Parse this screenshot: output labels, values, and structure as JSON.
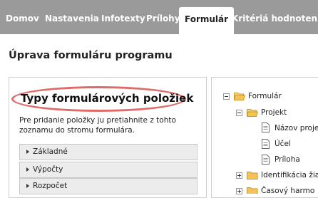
{
  "nav": {
    "tabs": [
      {
        "label": "Domov"
      },
      {
        "label": "Nastavenia"
      },
      {
        "label": "Infotexty"
      },
      {
        "label": "Prílohy"
      },
      {
        "label": "Formulár",
        "active": true
      },
      {
        "label": "Kritériá hodnotenia"
      }
    ]
  },
  "page": {
    "title": "Úprava formuláru programu"
  },
  "left_panel": {
    "heading": "Typy formulárových položiek",
    "instructions": "Pre pridanie položky ju pretiahnite z tohto zoznamu do stromu formulára.",
    "items": [
      {
        "label": "Základné"
      },
      {
        "label": "Výpočty"
      },
      {
        "label": "Rozpočet"
      }
    ]
  },
  "tree": {
    "nodes": [
      {
        "label": "Formulár",
        "type": "folder",
        "state": "expanded"
      },
      {
        "label": "Projekt",
        "type": "folder",
        "state": "expanded"
      },
      {
        "label": "Názov proje",
        "type": "document"
      },
      {
        "label": "Účel",
        "type": "document"
      },
      {
        "label": "Príloha",
        "type": "document"
      },
      {
        "label": "Identifikácia žia",
        "type": "folder",
        "state": "collapsed"
      },
      {
        "label": "Časový harmo",
        "type": "folder",
        "state": "collapsed"
      }
    ]
  },
  "colors": {
    "nav_background": "#9a9a9a",
    "highlight_ring": "#e06a68",
    "folder": "#f2c45a"
  }
}
